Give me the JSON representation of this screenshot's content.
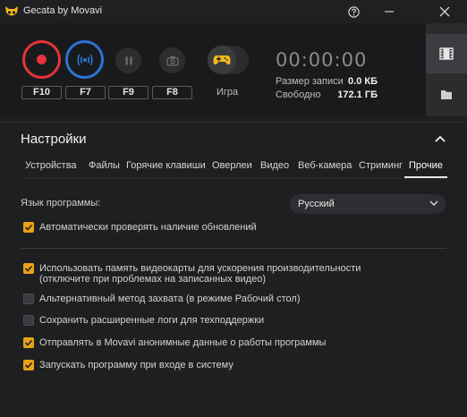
{
  "window": {
    "title": "Gecata by Movavi",
    "help_icon": "question-circle-icon",
    "minimize_icon": "minus-icon",
    "close_icon": "close-icon"
  },
  "controls": {
    "hotkeys": [
      "F10",
      "F7",
      "F9",
      "F8"
    ],
    "game_label": "Игра",
    "timer": "00:00:00",
    "record_size_label": "Размер записи",
    "record_size_value": "0.0 КБ",
    "free_label": "Свободно",
    "free_value": "172.1 ГБ"
  },
  "side_panel": {
    "video_icon": "film-icon",
    "folder_icon": "folder-icon"
  },
  "settings": {
    "title": "Настройки",
    "tabs": [
      {
        "label": "Устройства",
        "active": false
      },
      {
        "label": "Файлы",
        "active": false
      },
      {
        "label": "Горячие клавиши",
        "active": false
      },
      {
        "label": "Оверлеи",
        "active": false
      },
      {
        "label": "Видео",
        "active": false
      },
      {
        "label": "Веб-камера",
        "active": false
      },
      {
        "label": "Стриминг",
        "active": false
      },
      {
        "label": "Прочие",
        "active": true
      }
    ],
    "language_label": "Язык программы:",
    "language_value": "Русский",
    "auto_update": {
      "label": "Автоматически проверять наличие обновлений",
      "checked": true
    },
    "options": [
      {
        "label": "Использовать память видеокарты для ускорения производительности",
        "label2": "(отключите при проблемах на записанных видео)",
        "checked": true
      },
      {
        "label": "Альтернативный метод захвата (в режиме Рабочий стол)",
        "checked": false
      },
      {
        "label": "Сохранить расширенные логи для техподдержки",
        "checked": false
      },
      {
        "label": "Отправлять в Movavi анонимные данные о работы программы",
        "checked": true
      },
      {
        "label": "Запускать программу при входе в систему",
        "checked": true
      }
    ]
  },
  "colors": {
    "record_red": "#e6333c",
    "stream_blue": "#2c74d6",
    "checkbox_orange": "#e8a318",
    "game_yellow": "#f5b81e"
  }
}
